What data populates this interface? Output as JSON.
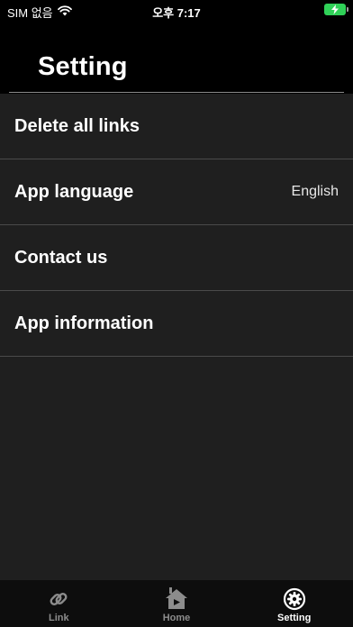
{
  "status_bar": {
    "carrier": "SIM 없음",
    "time": "오후 7:17"
  },
  "header": {
    "title": "Setting"
  },
  "settings": [
    {
      "label": "Delete all links",
      "value": ""
    },
    {
      "label": "App language",
      "value": "English"
    },
    {
      "label": "Contact us",
      "value": ""
    },
    {
      "label": "App information",
      "value": ""
    }
  ],
  "tab_bar": {
    "tabs": [
      {
        "label": "Link",
        "icon": "link-icon",
        "active": false
      },
      {
        "label": "Home",
        "icon": "home-icon",
        "active": false
      },
      {
        "label": "Setting",
        "icon": "gear-icon",
        "active": true
      }
    ]
  },
  "colors": {
    "background": "#1f1f1f",
    "header": "#000000",
    "battery": "#30d158",
    "inactive_tab": "#8c8c8c"
  }
}
